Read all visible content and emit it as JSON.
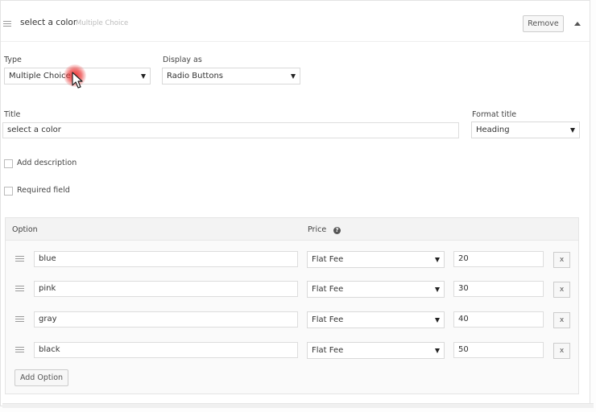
{
  "header": {
    "title": "select a color",
    "subtitle": "Multiple Choice",
    "remove_label": "Remove"
  },
  "type_field": {
    "label": "Type",
    "value": "Multiple Choice"
  },
  "display_field": {
    "label": "Display as",
    "value": "Radio Buttons"
  },
  "title_field": {
    "label": "Title",
    "value": "select a color"
  },
  "format_field": {
    "label": "Format title",
    "value": "Heading"
  },
  "add_description": {
    "label": "Add description",
    "checked": false
  },
  "required_field": {
    "label": "Required field",
    "checked": false
  },
  "options_table": {
    "col_option": "Option",
    "col_price": "Price",
    "help_glyph": "?",
    "rows": [
      {
        "option": "blue",
        "price_type": "Flat Fee",
        "price": "20",
        "remove": "x"
      },
      {
        "option": "pink",
        "price_type": "Flat Fee",
        "price": "30",
        "remove": "x"
      },
      {
        "option": "gray",
        "price_type": "Flat Fee",
        "price": "40",
        "remove": "x"
      },
      {
        "option": "black",
        "price_type": "Flat Fee",
        "price": "50",
        "remove": "x"
      }
    ],
    "add_label": "Add Option"
  }
}
